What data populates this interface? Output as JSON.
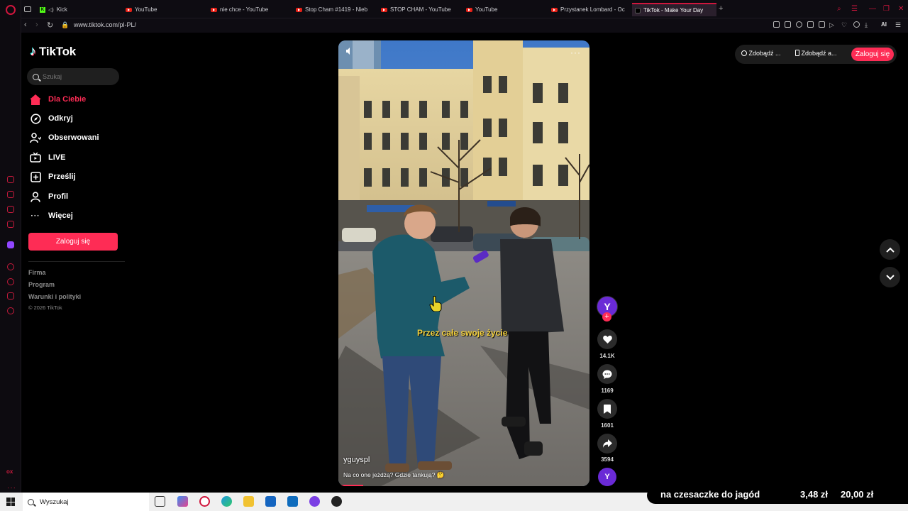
{
  "browser": {
    "tabs": [
      {
        "label": "Kick",
        "icon": "kick-icon"
      },
      {
        "label": "YouTube",
        "icon": "youtube-icon"
      },
      {
        "label": "nie chce - YouTube",
        "icon": "youtube-icon"
      },
      {
        "label": "Stop Cham #1419 - Nieb",
        "icon": "youtube-icon"
      },
      {
        "label": "STOP CHAM - YouTube",
        "icon": "youtube-icon"
      },
      {
        "label": "YouTube",
        "icon": "youtube-icon"
      },
      {
        "label": "Przystanek Lombard - Oc",
        "icon": "youtube-icon"
      },
      {
        "label": "TikTok - Make Your Day",
        "icon": "tiktok-icon",
        "active": true
      }
    ],
    "url": "www.tiktok.com/pl-PL/",
    "ai_label": "AI",
    "accent": "#d0163d"
  },
  "tiktok": {
    "logo": "TikTok",
    "search_placeholder": "Szukaj",
    "nav": [
      {
        "label": "Dla Ciebie",
        "icon": "home-icon",
        "active": true
      },
      {
        "label": "Odkryj",
        "icon": "compass-icon"
      },
      {
        "label": "Obserwowani",
        "icon": "following-icon"
      },
      {
        "label": "LIVE",
        "icon": "live-icon"
      },
      {
        "label": "Prześlij",
        "icon": "upload-icon"
      },
      {
        "label": "Profil",
        "icon": "profile-icon"
      },
      {
        "label": "Więcej",
        "icon": "more-icon"
      }
    ],
    "login_label": "Zaloguj się",
    "footer": [
      "Firma",
      "Program",
      "Warunki i polityki"
    ],
    "copyright": "© 2026 TikTok",
    "brand_color": "#fe2c55",
    "top_right": {
      "item1": "Zdobądź ...",
      "item2": "Zdobądź a...",
      "login": "Zaloguj się"
    }
  },
  "video": {
    "subtitle": "Przez całe swoje życie",
    "author": "yguyspl",
    "description": "Na co one jeżdżą? Gdzie tankują? 🤔",
    "likes": "14.1K",
    "comments": "1169",
    "saves": "1601",
    "shares": "3594",
    "progress": 0.1
  },
  "taskbar": {
    "search_label": "Wyszukaj"
  },
  "overlay": {
    "text": "na czesaczke do jagód",
    "value1": "3,48 zł",
    "value2": "20,00 zł"
  }
}
